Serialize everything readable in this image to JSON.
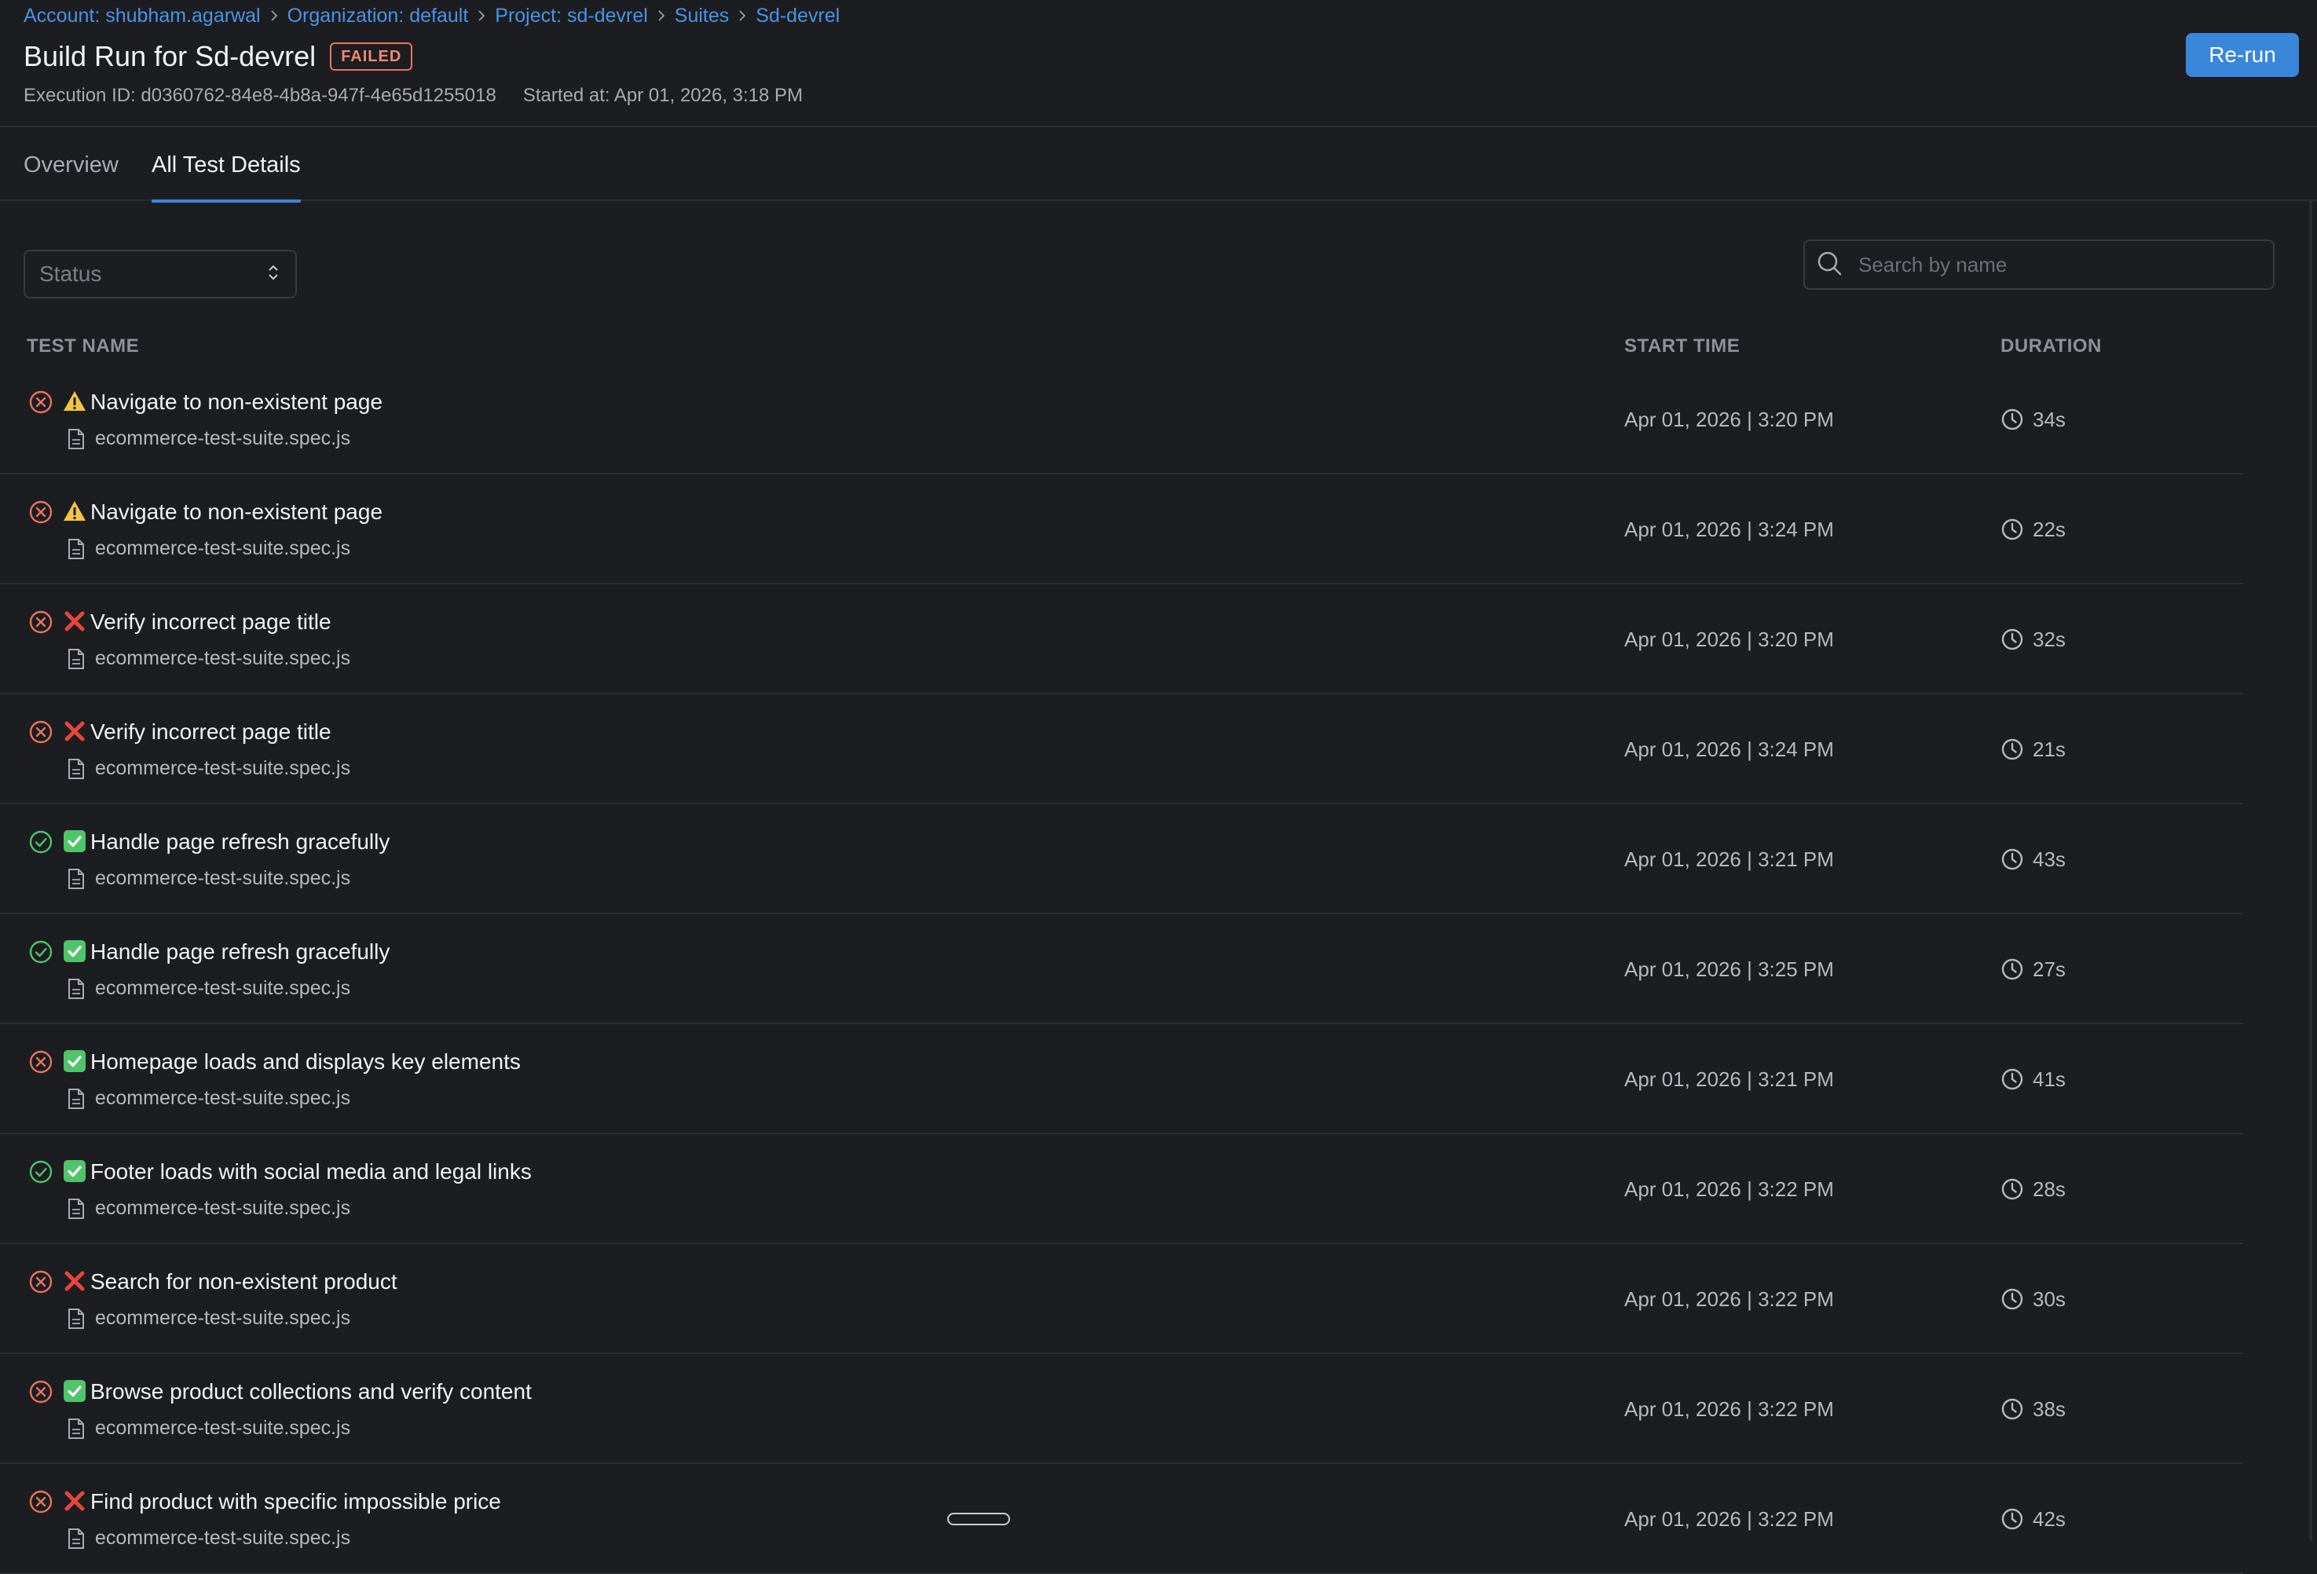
{
  "breadcrumb": [
    {
      "label": "Account: shubham.agarwal"
    },
    {
      "label": "Organization: default"
    },
    {
      "label": "Project: sd-devrel"
    },
    {
      "label": "Suites"
    },
    {
      "label": "Sd-devrel"
    }
  ],
  "header": {
    "title": "Build Run for Sd-devrel",
    "status_badge": "FAILED",
    "execution_id": "Execution ID: d0360762-84e8-4b8a-947f-4e65d1255018",
    "started_at": "Started at: Apr 01, 2026, 3:18 PM",
    "rerun_label": "Re-run"
  },
  "tabs": [
    {
      "label": "Overview",
      "active": false
    },
    {
      "label": "All Test Details",
      "active": true
    }
  ],
  "filters": {
    "status_placeholder": "Status",
    "search_placeholder": "Search by name"
  },
  "table": {
    "columns": {
      "name": "TEST NAME",
      "start": "START TIME",
      "duration": "DURATION"
    },
    "rows": [
      {
        "status": "failed",
        "marker": "warning",
        "name": "Navigate to non-existent page",
        "file": "ecommerce-test-suite.spec.js",
        "start": "Apr 01, 2026 | 3:20 PM",
        "duration": "34s"
      },
      {
        "status": "failed",
        "marker": "warning",
        "name": "Navigate to non-existent page",
        "file": "ecommerce-test-suite.spec.js",
        "start": "Apr 01, 2026 | 3:24 PM",
        "duration": "22s"
      },
      {
        "status": "failed",
        "marker": "cross",
        "name": "Verify incorrect page title",
        "file": "ecommerce-test-suite.spec.js",
        "start": "Apr 01, 2026 | 3:20 PM",
        "duration": "32s"
      },
      {
        "status": "failed",
        "marker": "cross",
        "name": "Verify incorrect page title",
        "file": "ecommerce-test-suite.spec.js",
        "start": "Apr 01, 2026 | 3:24 PM",
        "duration": "21s"
      },
      {
        "status": "passed",
        "marker": "check",
        "name": "Handle page refresh gracefully",
        "file": "ecommerce-test-suite.spec.js",
        "start": "Apr 01, 2026 | 3:21 PM",
        "duration": "43s"
      },
      {
        "status": "passed",
        "marker": "check",
        "name": "Handle page refresh gracefully",
        "file": "ecommerce-test-suite.spec.js",
        "start": "Apr 01, 2026 | 3:25 PM",
        "duration": "27s"
      },
      {
        "status": "failed",
        "marker": "check",
        "name": "Homepage loads and displays key elements",
        "file": "ecommerce-test-suite.spec.js",
        "start": "Apr 01, 2026 | 3:21 PM",
        "duration": "41s"
      },
      {
        "status": "passed",
        "marker": "check",
        "name": "Footer loads with social media and legal links",
        "file": "ecommerce-test-suite.spec.js",
        "start": "Apr 01, 2026 | 3:22 PM",
        "duration": "28s"
      },
      {
        "status": "failed",
        "marker": "cross",
        "name": "Search for non-existent product",
        "file": "ecommerce-test-suite.spec.js",
        "start": "Apr 01, 2026 | 3:22 PM",
        "duration": "30s"
      },
      {
        "status": "failed",
        "marker": "check",
        "name": "Browse product collections and verify content",
        "file": "ecommerce-test-suite.spec.js",
        "start": "Apr 01, 2026 | 3:22 PM",
        "duration": "38s"
      },
      {
        "status": "failed",
        "marker": "cross",
        "name": "Find product with specific impossible price",
        "file": "ecommerce-test-suite.spec.js",
        "start": "Apr 01, 2026 | 3:22 PM",
        "duration": "42s"
      }
    ]
  },
  "colors": {
    "accent": "#3a86db",
    "failed": "#e8745f",
    "passed": "#4fc46b",
    "warning": "#f4c542",
    "cross": "#e8453c"
  },
  "icons": {
    "failed": "x-circle-icon",
    "passed": "check-circle-icon",
    "warning": "warning-icon",
    "cross": "cross-mark-icon",
    "check": "check-box-icon"
  }
}
